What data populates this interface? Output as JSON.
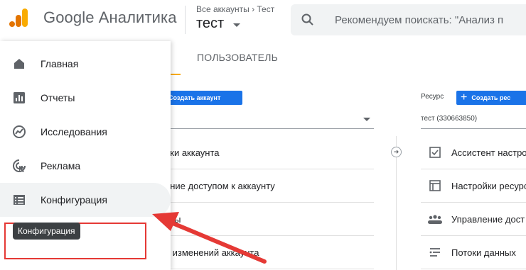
{
  "header": {
    "brand": "Google Аналитика",
    "breadcrumb": "Все аккаунты › Тест",
    "property": "тест",
    "search_placeholder": "Рекомендуем поискать: \"Анализ п"
  },
  "sidebar": {
    "items": [
      {
        "label": "Главная",
        "icon": "home-icon"
      },
      {
        "label": "Отчеты",
        "icon": "reports-icon"
      },
      {
        "label": "Исследования",
        "icon": "explore-icon"
      },
      {
        "label": "Реклама",
        "icon": "advertising-icon"
      },
      {
        "label": "Конфигурация",
        "icon": "configure-icon"
      }
    ],
    "tooltip": "Конфигурация"
  },
  "main": {
    "tab_user": "ПОЛЬЗОВАТЕЛЬ",
    "create_account_btn": "Создать аккаунт",
    "resource_label": "Ресурс",
    "create_property_btn": "Создать рес",
    "property_select": "тест (330663850)",
    "account_rows": [
      "йки аккаунта",
      "ение доступом к аккаунту",
      "тры",
      "я изменений аккаунта"
    ],
    "property_rows": [
      {
        "label": "Ассистент настро",
        "icon": "checklist-icon"
      },
      {
        "label": "Настройки ресурс",
        "icon": "layout-icon"
      },
      {
        "label": "Управление дост",
        "icon": "people-icon"
      },
      {
        "label": "Потоки данных",
        "icon": "streams-icon"
      }
    ]
  },
  "colors": {
    "accent_blue": "#1a73e8",
    "annotation_red": "#e53935",
    "logo_orange": "#f9ab00",
    "logo_dark_orange": "#e37400"
  }
}
